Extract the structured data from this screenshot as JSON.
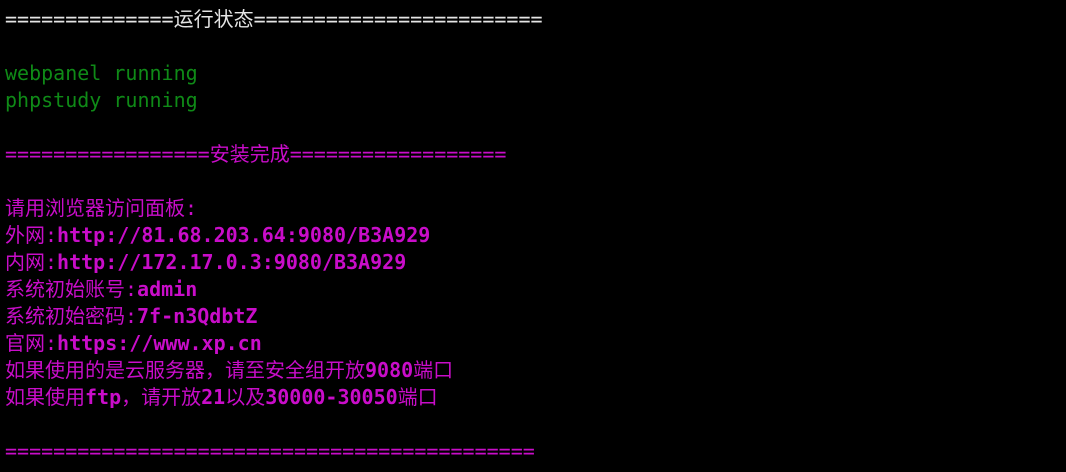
{
  "colors": {
    "background": "#000000",
    "status_text": "#e5e5e5",
    "running": "#0f8a17",
    "install_info": "#c90dc9"
  },
  "terminal": {
    "status_header": "==============运行状态========================",
    "running_lines": [
      "webpanel running",
      "phpstudy running"
    ],
    "install_header": "=================安装完成==================",
    "info_title": "请用浏览器访问面板:",
    "info_lines": [
      {
        "label": "外网:",
        "value": "http://81.68.203.64:9080/B3A929"
      },
      {
        "label": "内网:",
        "value": "http://172.17.0.3:9080/B3A929"
      },
      {
        "label": "系统初始账号:",
        "value": "admin"
      },
      {
        "label": "系统初始密码:",
        "value": "7f-n3QdbtZ"
      },
      {
        "label": "官网:",
        "value": "https://www.xp.cn"
      }
    ],
    "notice_cloud": {
      "prefix": "如果使用的是云服务器，请至安全组开放",
      "port": "9080",
      "suffix": "端口"
    },
    "notice_ftp": {
      "prefix": "如果使用",
      "ftp": "ftp",
      "middle": "，请开放",
      "port_a": "21",
      "and": "以及",
      "port_range": "30000-30050",
      "suffix": "端口"
    },
    "footer_rule": "============================================"
  }
}
